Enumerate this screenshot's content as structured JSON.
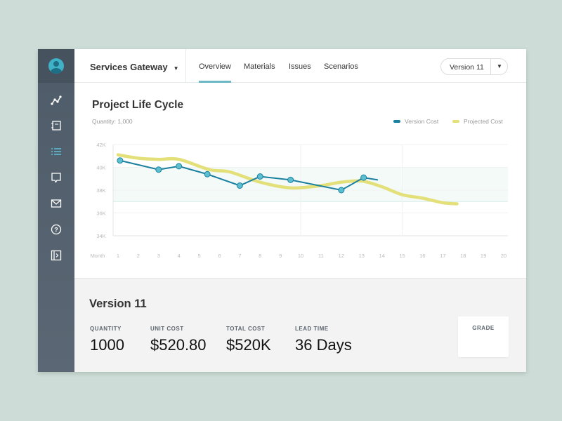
{
  "header": {
    "project": "Services Gateway",
    "tabs": [
      "Overview",
      "Materials",
      "Issues",
      "Scenarios"
    ],
    "active_tab": "Overview",
    "version_select": "Version 11"
  },
  "sidebar": {
    "items": [
      {
        "icon": "chart-line-icon"
      },
      {
        "icon": "notebook-icon"
      },
      {
        "icon": "list-icon",
        "active": true
      },
      {
        "icon": "comment-icon"
      },
      {
        "icon": "mail-icon"
      },
      {
        "icon": "help-icon"
      },
      {
        "icon": "collapse-panel-icon"
      }
    ]
  },
  "chart_title": "Project Life Cycle",
  "chart_subtitle": "Quantity: 1,000",
  "colors": {
    "version": "#1b7fa0",
    "projected": "#e3e07a",
    "accent": "#6cb8c7",
    "sidebar": "#52606d"
  },
  "chart_data": {
    "type": "line",
    "xlabel": "Month",
    "x_ticks": [
      1,
      2,
      3,
      4,
      5,
      6,
      7,
      8,
      9,
      10,
      11,
      12,
      13,
      14,
      15,
      16,
      17,
      18,
      19,
      20
    ],
    "y_ticks": [
      "34K",
      "36K",
      "38K",
      "40K",
      "42K"
    ],
    "ylim": [
      34,
      42
    ],
    "xlim": [
      1,
      20
    ],
    "band": [
      37,
      40
    ],
    "legend": "top-right",
    "series": [
      {
        "name": "Version Cost",
        "markers": true,
        "points": [
          [
            1.1,
            40.6
          ],
          [
            3,
            39.8
          ],
          [
            4,
            40.1
          ],
          [
            5.4,
            39.4
          ],
          [
            7,
            38.4
          ],
          [
            8,
            39.2
          ],
          [
            9.5,
            38.9
          ],
          [
            12,
            38.0
          ],
          [
            13.1,
            39.1
          ],
          [
            13.8,
            38.9
          ]
        ]
      },
      {
        "name": "Projected Cost",
        "markers": false,
        "points": [
          [
            1,
            41.1
          ],
          [
            2,
            40.8
          ],
          [
            3,
            40.7
          ],
          [
            4,
            40.7
          ],
          [
            5.5,
            39.8
          ],
          [
            6.5,
            39.6
          ],
          [
            8,
            38.7
          ],
          [
            9.5,
            38.2
          ],
          [
            11,
            38.4
          ],
          [
            12,
            38.7
          ],
          [
            13,
            38.8
          ],
          [
            14,
            38.3
          ],
          [
            15,
            37.6
          ],
          [
            16,
            37.3
          ],
          [
            17,
            36.9
          ],
          [
            17.7,
            36.8
          ]
        ]
      }
    ]
  },
  "summary": {
    "title": "Version 11",
    "stats": [
      {
        "label": "QUANTITY",
        "value": "1000"
      },
      {
        "label": "UNIT COST",
        "value": "$520.80"
      },
      {
        "label": "TOTAL COST",
        "value": "$520K"
      },
      {
        "label": "LEAD TIME",
        "value": "36 Days"
      }
    ],
    "grade_label": "GRADE"
  }
}
